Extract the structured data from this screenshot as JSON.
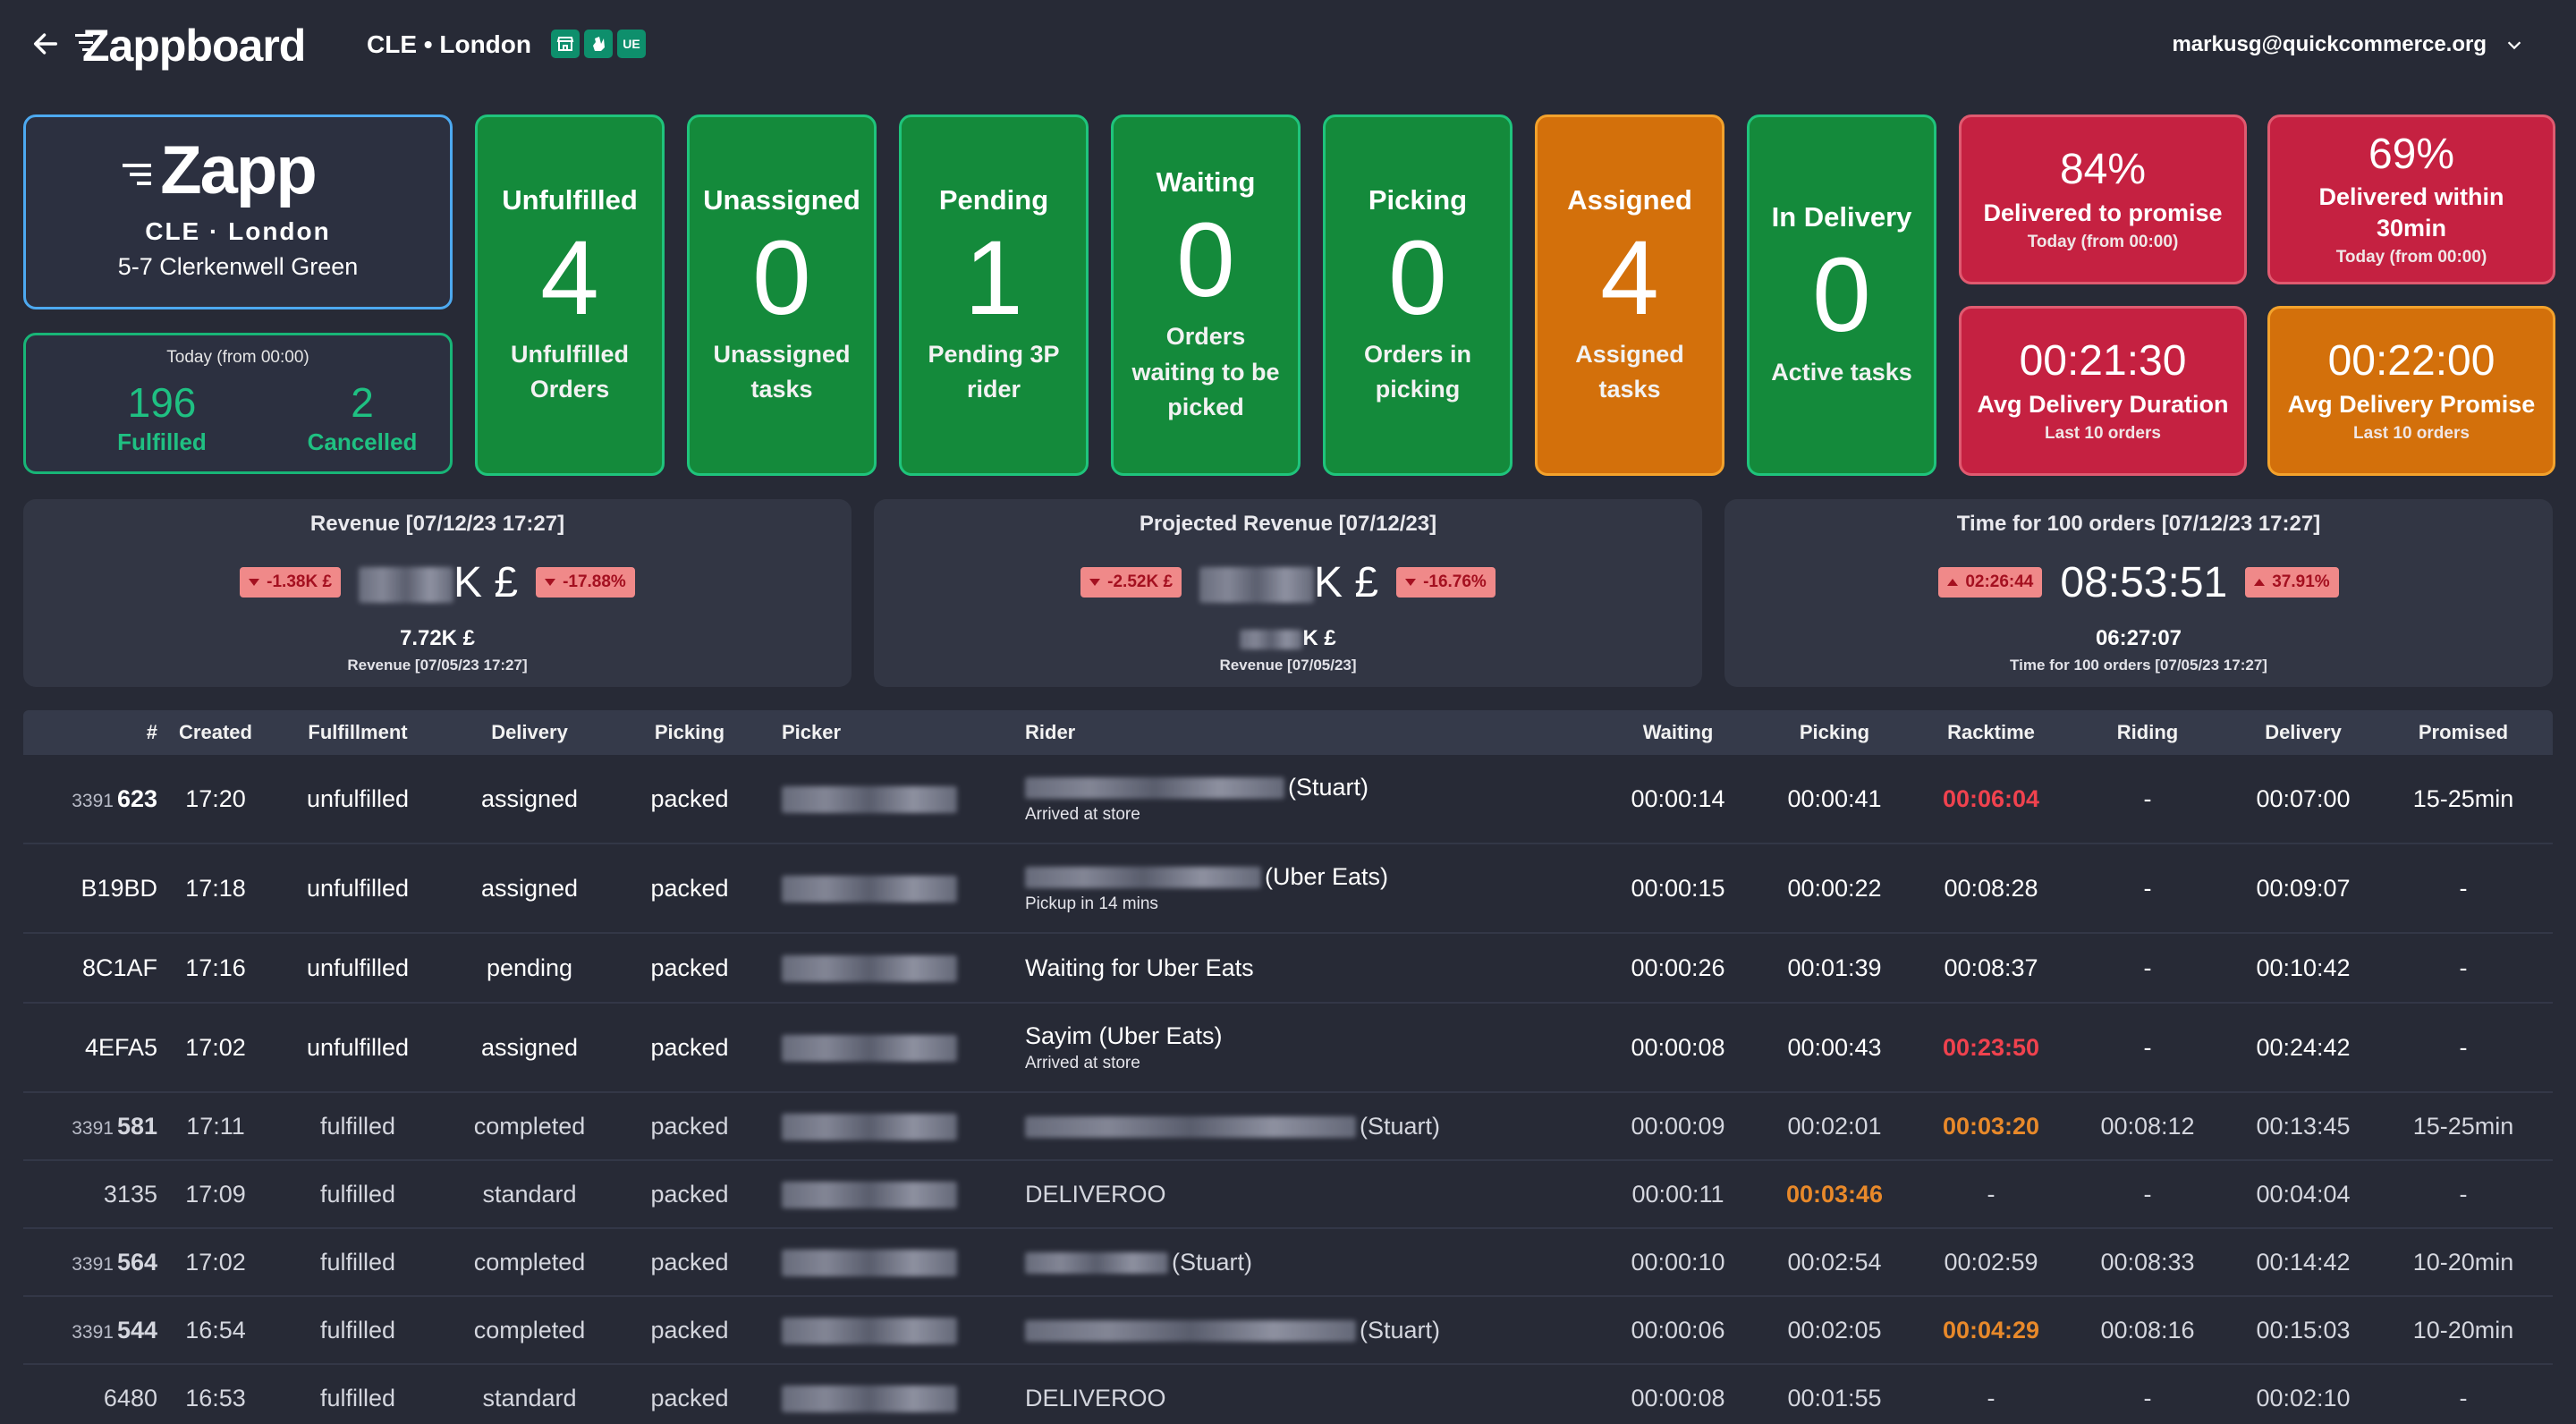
{
  "header": {
    "brand": "Zappboard",
    "store_label": "CLE • London",
    "channels": [
      "store-icon",
      "deliveroo-icon",
      "UE"
    ],
    "user_email": "markusg@quickcommerce.org"
  },
  "store": {
    "logo_text": "Zapp",
    "code": "CLE · London",
    "address": "5-7 Clerkenwell Green"
  },
  "today": {
    "header": "Today (from 00:00)",
    "fulfilled_value": "196",
    "fulfilled_label": "Fulfilled",
    "cancelled_value": "2",
    "cancelled_label": "Cancelled"
  },
  "status_cards": [
    {
      "title": "Unfulfilled",
      "value": "4",
      "subtitle": "Unfulfilled Orders",
      "color": "#148a3b"
    },
    {
      "title": "Unassigned",
      "value": "0",
      "subtitle": "Unassigned tasks",
      "color": "#148a3b"
    },
    {
      "title": "Pending",
      "value": "1",
      "subtitle": "Pending 3P rider",
      "color": "#148a3b"
    },
    {
      "title": "Waiting",
      "value": "0",
      "subtitle": "Orders waiting to be picked",
      "color": "#148a3b"
    },
    {
      "title": "Picking",
      "value": "0",
      "subtitle": "Orders in picking",
      "color": "#148a3b"
    },
    {
      "title": "Assigned",
      "value": "4",
      "subtitle": "Assigned tasks",
      "color": "#d3700b"
    },
    {
      "title": "In Delivery",
      "value": "0",
      "subtitle": "Active tasks",
      "color": "#148a3b"
    }
  ],
  "metrics": {
    "delivered_to_promise": {
      "value": "84%",
      "label": "Delivered to promise",
      "note": "Today (from 00:00)",
      "color": "#c52141"
    },
    "delivered_30min": {
      "value": "69%",
      "label": "Delivered within 30min",
      "note": "Today (from 00:00)",
      "color": "#c52141"
    },
    "avg_duration": {
      "value": "00:21:30",
      "label": "Avg Delivery Duration",
      "note": "Last 10 orders",
      "color": "#c52141"
    },
    "avg_promise": {
      "value": "00:22:00",
      "label": "Avg Delivery Promise",
      "note": "Last 10 orders",
      "color": "#d3700b"
    }
  },
  "revenue": {
    "title": "Revenue [07/12/23 17:27]",
    "left_badge": "-1.38K £",
    "value_suffix": "K £",
    "right_badge": "-17.88%",
    "previous_value": "7.72K £",
    "previous_label": "Revenue [07/05/23 17:27]"
  },
  "projected": {
    "title": "Projected Revenue [07/12/23]",
    "left_badge": "-2.52K £",
    "value_suffix": "K £",
    "right_badge": "-16.76%",
    "previous_value_suffix": "K £",
    "previous_label": "Revenue [07/05/23]"
  },
  "time100": {
    "title": "Time for 100 orders [07/12/23 17:27]",
    "left_badge": "02:26:44",
    "value": "08:53:51",
    "right_badge": "37.91%",
    "previous_value": "06:27:07",
    "previous_label": "Time for 100 orders [07/05/23 17:27]"
  },
  "table": {
    "columns": [
      "#",
      "Created",
      "Fulfillment",
      "Delivery",
      "Picking",
      "Picker",
      "Rider",
      "Waiting",
      "Picking",
      "Racktime",
      "Riding",
      "Delivery",
      "Promised"
    ],
    "rows": [
      {
        "prefix": "3391",
        "id": "623",
        "created": "17:20",
        "fulfillment": "unfulfilled",
        "delivery": "assigned",
        "picking": "packed",
        "rider_suffix": "(Stuart)",
        "rider_sub": "Arrived at store",
        "waiting": "00:00:14",
        "pick_time": "00:00:41",
        "racktime": "00:06:04",
        "racktime_color": "red",
        "riding": "-",
        "delivery_time": "00:07:00",
        "promised": "15-25min"
      },
      {
        "prefix": "",
        "id": "B19BD",
        "created": "17:18",
        "fulfillment": "unfulfilled",
        "delivery": "assigned",
        "picking": "packed",
        "rider_suffix": "(Uber Eats)",
        "rider_sub": "Pickup in 14 mins",
        "waiting": "00:00:15",
        "pick_time": "00:00:22",
        "racktime": "00:08:28",
        "racktime_color": "",
        "riding": "-",
        "delivery_time": "00:09:07",
        "promised": "-"
      },
      {
        "prefix": "",
        "id": "8C1AF",
        "created": "17:16",
        "fulfillment": "unfulfilled",
        "delivery": "pending",
        "picking": "packed",
        "rider_text": "Waiting for Uber Eats",
        "waiting": "00:00:26",
        "pick_time": "00:01:39",
        "racktime": "00:08:37",
        "racktime_color": "",
        "riding": "-",
        "delivery_time": "00:10:42",
        "promised": "-"
      },
      {
        "prefix": "",
        "id": "4EFA5",
        "created": "17:02",
        "fulfillment": "unfulfilled",
        "delivery": "assigned",
        "picking": "packed",
        "rider_text": "Sayim (Uber Eats)",
        "rider_sub": "Arrived at store",
        "waiting": "00:00:08",
        "pick_time": "00:00:43",
        "racktime": "00:23:50",
        "racktime_color": "red",
        "riding": "-",
        "delivery_time": "00:24:42",
        "promised": "-"
      },
      {
        "prefix": "3391",
        "id": "581",
        "created": "17:11",
        "fulfillment": "fulfilled",
        "delivery": "completed",
        "picking": "packed",
        "rider_suffix": "(Stuart)",
        "waiting": "00:00:09",
        "pick_time": "00:02:01",
        "racktime": "00:03:20",
        "racktime_color": "orange",
        "riding": "00:08:12",
        "delivery_time": "00:13:45",
        "promised": "15-25min"
      },
      {
        "prefix": "",
        "id": "3135",
        "created": "17:09",
        "fulfillment": "fulfilled",
        "delivery": "standard",
        "picking": "packed",
        "rider_text": "DELIVEROO",
        "waiting": "00:00:11",
        "pick_time": "00:03:46",
        "pick_color": "orange",
        "racktime": "-",
        "racktime_color": "",
        "riding": "-",
        "delivery_time": "00:04:04",
        "promised": "-"
      },
      {
        "prefix": "3391",
        "id": "564",
        "created": "17:02",
        "fulfillment": "fulfilled",
        "delivery": "completed",
        "picking": "packed",
        "rider_suffix": "(Stuart)",
        "waiting": "00:00:10",
        "pick_time": "00:02:54",
        "racktime": "00:02:59",
        "racktime_color": "",
        "riding": "00:08:33",
        "delivery_time": "00:14:42",
        "promised": "10-20min"
      },
      {
        "prefix": "3391",
        "id": "544",
        "created": "16:54",
        "fulfillment": "fulfilled",
        "delivery": "completed",
        "picking": "packed",
        "rider_suffix": "(Stuart)",
        "waiting": "00:00:06",
        "pick_time": "00:02:05",
        "racktime": "00:04:29",
        "racktime_color": "orange",
        "riding": "00:08:16",
        "delivery_time": "00:15:03",
        "promised": "10-20min"
      },
      {
        "prefix": "",
        "id": "6480",
        "created": "16:53",
        "fulfillment": "fulfilled",
        "delivery": "standard",
        "picking": "packed",
        "rider_text": "DELIVEROO",
        "waiting": "00:00:08",
        "pick_time": "00:01:55",
        "racktime": "-",
        "racktime_color": "",
        "riding": "-",
        "delivery_time": "00:02:10",
        "promised": "-"
      }
    ]
  }
}
